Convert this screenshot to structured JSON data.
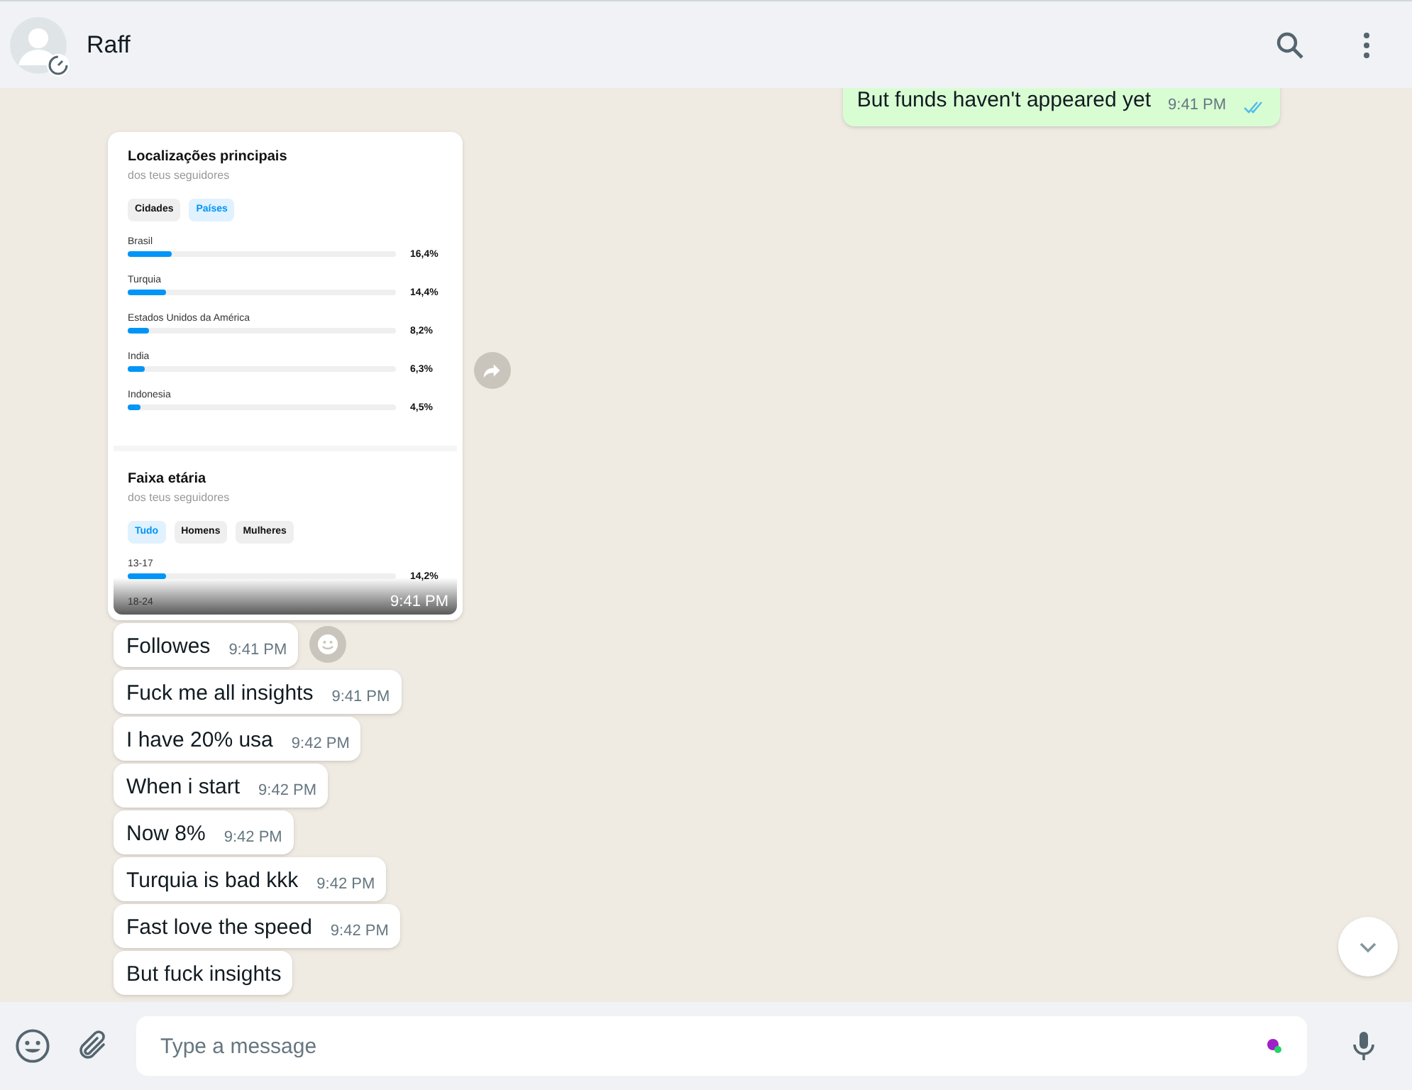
{
  "header": {
    "contact_name": "Raff"
  },
  "outgoing": {
    "text": "But funds haven't appeared yet",
    "time": "9:41 PM",
    "read": true
  },
  "image_message": {
    "time": "9:41 PM",
    "sections": [
      {
        "title": "Localizações principais",
        "subtitle": "dos teus seguidores",
        "tabs": [
          {
            "label": "Cidades",
            "selected": false
          },
          {
            "label": "Países",
            "selected": true
          }
        ],
        "rows": [
          {
            "label": "Brasil",
            "value": "16,4%",
            "level": 0.164
          },
          {
            "label": "Turquia",
            "value": "14,4%",
            "level": 0.144
          },
          {
            "label": "Estados Unidos da América",
            "value": "8,2%",
            "level": 0.082
          },
          {
            "label": "India",
            "value": "6,3%",
            "level": 0.063
          },
          {
            "label": "Indonesia",
            "value": "4,5%",
            "level": 0.045
          }
        ]
      },
      {
        "title": "Faixa etária",
        "subtitle": "dos teus seguidores",
        "tabs": [
          {
            "label": "Tudo",
            "selected": true
          },
          {
            "label": "Homens",
            "selected": false
          },
          {
            "label": "Mulheres",
            "selected": false
          }
        ],
        "rows": [
          {
            "label": "13-17",
            "value": "14,2%",
            "level": 0.142
          },
          {
            "label": "18-24"
          }
        ]
      }
    ]
  },
  "messages": [
    {
      "text": "Followes",
      "time": "9:41 PM",
      "react": true
    },
    {
      "text": "Fuck me all insights",
      "time": "9:41 PM",
      "react": false
    },
    {
      "text": "I have 20% usa",
      "time": "9:42 PM",
      "react": false
    },
    {
      "text": "When i start",
      "time": "9:42 PM",
      "react": false
    },
    {
      "text": "Now 8%",
      "time": "9:42 PM",
      "react": false
    },
    {
      "text": "Turquia is bad kkk",
      "time": "9:42 PM",
      "react": false
    },
    {
      "text": "Fast love the speed",
      "time": "9:42 PM",
      "react": false
    },
    {
      "text": "But fuck insights",
      "react": false
    }
  ],
  "composer": {
    "placeholder": "Type a message"
  }
}
